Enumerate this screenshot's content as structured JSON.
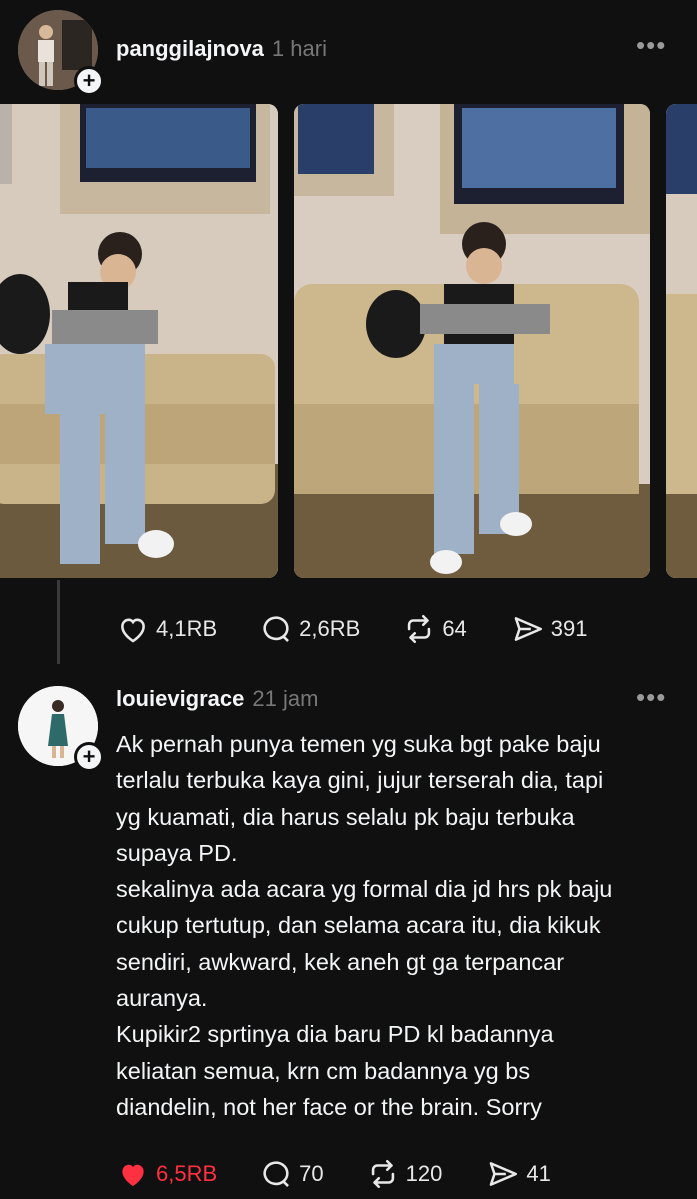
{
  "post": {
    "username": "panggilajnova",
    "time": "1 hari",
    "stats": {
      "likes": "4,1RB",
      "replies": "2,6RB",
      "reposts": "64",
      "shares": "391"
    }
  },
  "reply": {
    "username": "louievigrace",
    "time": "21 jam",
    "text": "Ak pernah punya temen yg suka bgt pake baju\nterlalu terbuka kaya gini, jujur terserah dia, tapi\nyg kuamati, dia harus selalu pk baju terbuka\nsupaya PD.\nsekalinya ada acara yg formal dia jd hrs pk baju\ncukup tertutup, dan selama acara itu, dia kikuk\nsendiri, awkward, kek aneh gt ga terpancar\nauranya.\nKupikir2 sprtinya dia baru PD kl badannya\nkeliatan semua, krn cm badannya yg bs\ndiandelin, not her face or the brain. Sorry",
    "stats": {
      "likes": "6,5RB",
      "replies": "70",
      "reposts": "120",
      "shares": "41"
    },
    "liked": true,
    "like_color": "#ff3040"
  },
  "icons": [
    "heart-icon",
    "comment-icon",
    "repost-icon",
    "share-icon",
    "more-icon",
    "plus-icon"
  ]
}
